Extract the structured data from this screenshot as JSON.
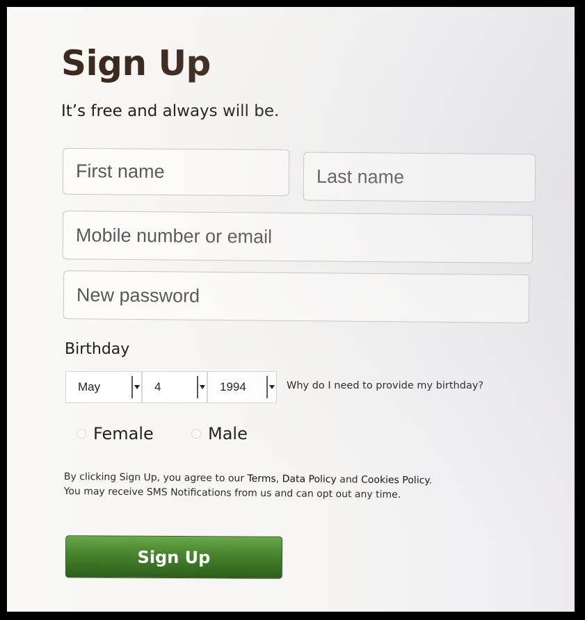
{
  "header": {
    "title": "Sign Up",
    "subtitle": "It’s free and always will be."
  },
  "form": {
    "first_name_placeholder": "First name",
    "last_name_placeholder": "Last name",
    "contact_placeholder": "Mobile number or email",
    "password_placeholder": "New password"
  },
  "birthday": {
    "label": "Birthday",
    "month": "May",
    "day": "4",
    "year": "1994",
    "why_link": "Why do I need to provide my birthday?"
  },
  "gender": {
    "female_label": "Female",
    "male_label": "Male"
  },
  "terms": {
    "prefix": "By clicking Sign Up, you agree to our ",
    "terms_link": "Terms",
    "sep1": ", ",
    "data_policy_link": "Data Policy",
    "and": " and ",
    "cookies_link": "Cookies Policy",
    "suffix": ". You may receive SMS Notifications from us and can opt out any time."
  },
  "submit": {
    "label": "Sign Up"
  },
  "colors": {
    "title": "#3d2a1e",
    "button_green": "#4d8b32"
  }
}
